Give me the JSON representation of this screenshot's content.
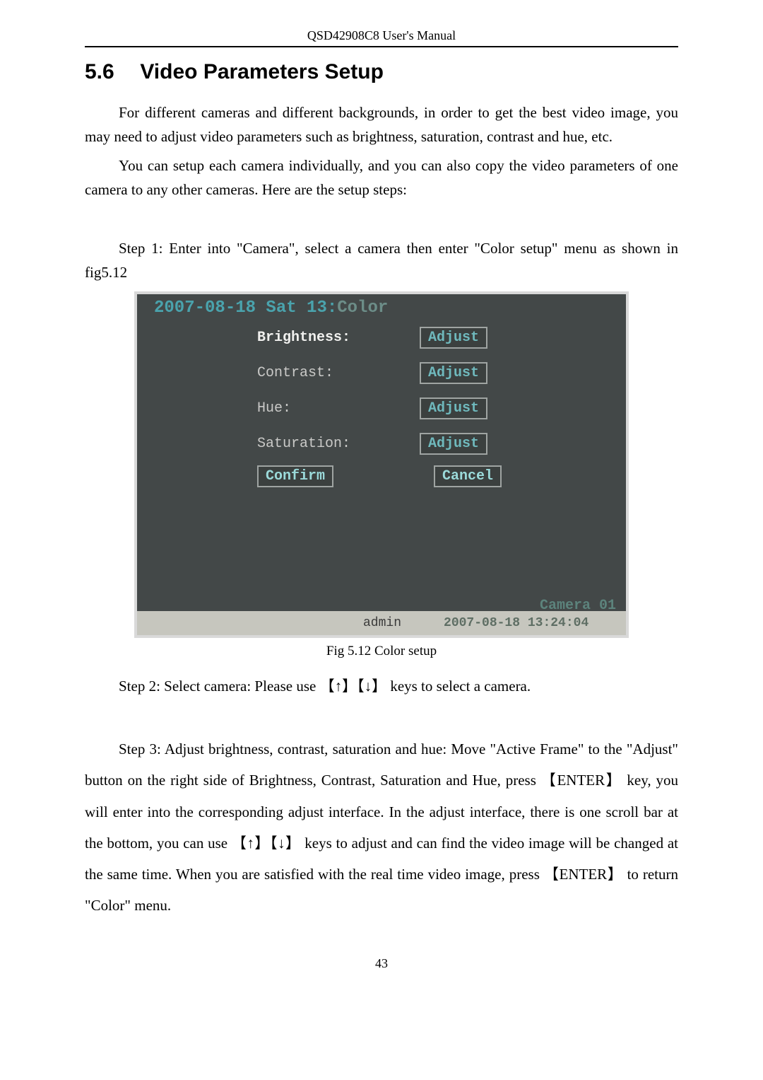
{
  "header": {
    "title": "QSD42908C8 User's Manual"
  },
  "section": {
    "number": "5.6",
    "title": "Video Parameters Setup"
  },
  "paragraphs": {
    "p1": "For different cameras and different backgrounds, in order to get the best video image, you may need to adjust video parameters such as brightness, saturation, contrast and hue, etc.",
    "p2": "You can setup each camera individually, and you can also copy the video parameters of one camera to any other cameras. Here are the setup steps:",
    "p3": "Step 1: Enter into \"Camera\", select a camera then enter \"Color setup\" menu as shown in fig5.12",
    "step2": "Step 2: Select camera: Please use 【↑】【↓】 keys to select a camera.",
    "step3a": "Step 3: Adjust brightness, contrast, saturation and hue: Move \"Active Frame\" to the \"Adjust\" button on the right side of Brightness, Contrast, Saturation and Hue, press  【ENTER】 key, you will enter into the corresponding adjust interface. In the adjust interface, there is one scroll bar at the bottom, you can use 【↑】【↓】 keys to adjust and can find the video image will be changed at the same time. When you are satisfied with the real time video image, press 【ENTER】 to return \"Color\" menu."
  },
  "osd": {
    "datetime_prefix": "2007-08-18 Sat 13:",
    "datetime_overlay": "Color",
    "rows": {
      "brightness": {
        "label": "Brightness:",
        "btn": "Adjust",
        "highlight": true
      },
      "contrast": {
        "label": "Contrast:",
        "btn": "Adjust"
      },
      "hue": {
        "label": "Hue:",
        "btn": "Adjust"
      },
      "saturation": {
        "label": "Saturation:",
        "btn": "Adjust"
      }
    },
    "confirm": "Confirm",
    "cancel": "Cancel",
    "camera_label": "Camera 01",
    "footer": {
      "user": "admin",
      "timestamp": "2007-08-18 13:24:04"
    }
  },
  "caption": "Fig 5.12 Color setup",
  "pagenum": "43"
}
